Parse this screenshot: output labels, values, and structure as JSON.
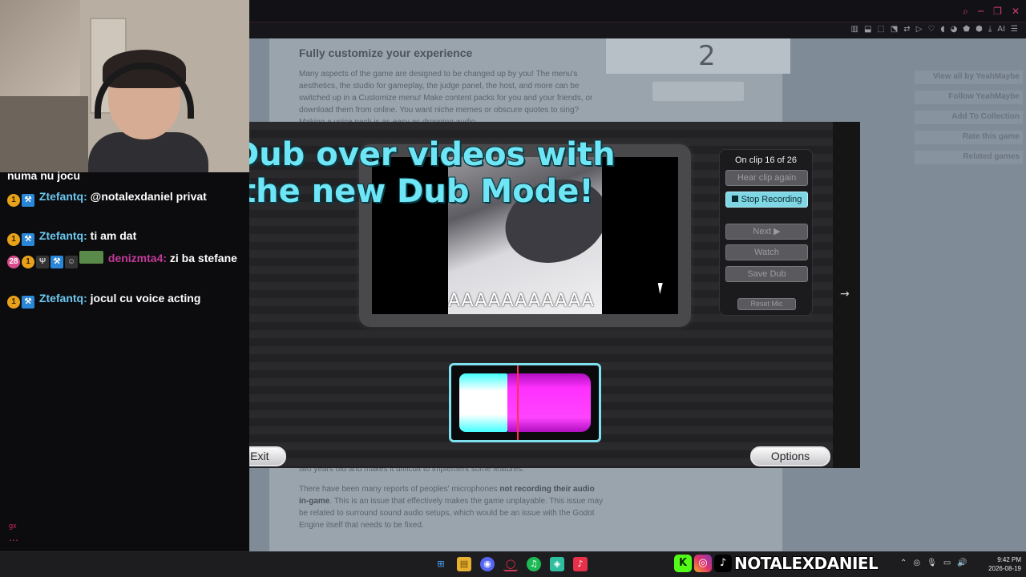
{
  "browser": {
    "window_controls": [
      "⌕",
      "─",
      "❐",
      "✕"
    ],
    "toolbar_icons": [
      "▥",
      "⬓",
      "⬚",
      "⬔",
      "⇄",
      "▷",
      "♡",
      "◖",
      "◕",
      "⬟",
      "⬢",
      "⤓",
      "AI",
      "☰"
    ]
  },
  "webpage": {
    "section_title": "Fully customize your experience",
    "paragraph": "Many aspects of the game are designed to be changed up by you! The menu's aesthetics, the studio for gameplay, the judge panel, the host, and more can be switched up in a Customize menu! Make content packs for you and your friends, or download them from online. You want niche memes or obscure quotes to sing? Making a voice pack is as easy as dropping audio",
    "bottom_para1": "two years old and makes it difficult to implement some features.",
    "bottom_para2_prefix": "There have been many reports of peoples' microphones ",
    "bottom_para2_bold": "not recording their audio in-game",
    "bottom_para2_suffix": ". This is an issue that effectively makes the game unplayable. This issue may be related to surround sound audio setups, which would be an issue with the Godot Engine itself that needs to be fixed.",
    "side_links": [
      "View all by YeahMaybe",
      "Follow YeahMaybe",
      "Add To Collection",
      "Rate this game",
      "Related games"
    ],
    "thumb_number": "2"
  },
  "game": {
    "promo_line1": "Dub over videos with",
    "promo_line2": "the new Dub Mode!",
    "clip_counter": "On clip 16 of 26",
    "buttons": {
      "hear_clip": "Hear clip again",
      "stop_recording": "Stop Recording",
      "next": "Next ▶",
      "watch": "Watch",
      "save_dub": "Save Dub",
      "reset_mic": "Reset Mic"
    },
    "video_caption": "AAAAAAAAAAA",
    "exit_label": "Exit",
    "exit_icon": "↩",
    "options_label": "Options",
    "nav_left": "←",
    "nav_right": "→",
    "accent_color": "#7fe0f0",
    "wave_color": "#ff44ff"
  },
  "chat": {
    "partial_top": "numa nu jocu",
    "messages": [
      {
        "user": "Ztefantq:",
        "text": "@notalexdaniel privat"
      },
      {
        "user": "Ztefantq:",
        "text": "ti am dat"
      },
      {
        "user": "denizmta4:",
        "text": "zi ba stefane"
      },
      {
        "user": "Ztefantq:",
        "text": "jocul cu voice acting"
      }
    ],
    "footer": "gx",
    "dots": "⋯"
  },
  "taskbar": {
    "icons": [
      "⊞",
      "▤",
      "◉",
      "◯",
      "♫",
      "◈",
      "♪"
    ],
    "tray": [
      "⌃",
      "◎",
      "🎙",
      "▭",
      "🔊"
    ],
    "time": "9:42 PM",
    "date": "2026-08-19",
    "social_handle": "NOTALEXDANIEL",
    "social_icons": [
      "K",
      "◎",
      "♪"
    ]
  }
}
